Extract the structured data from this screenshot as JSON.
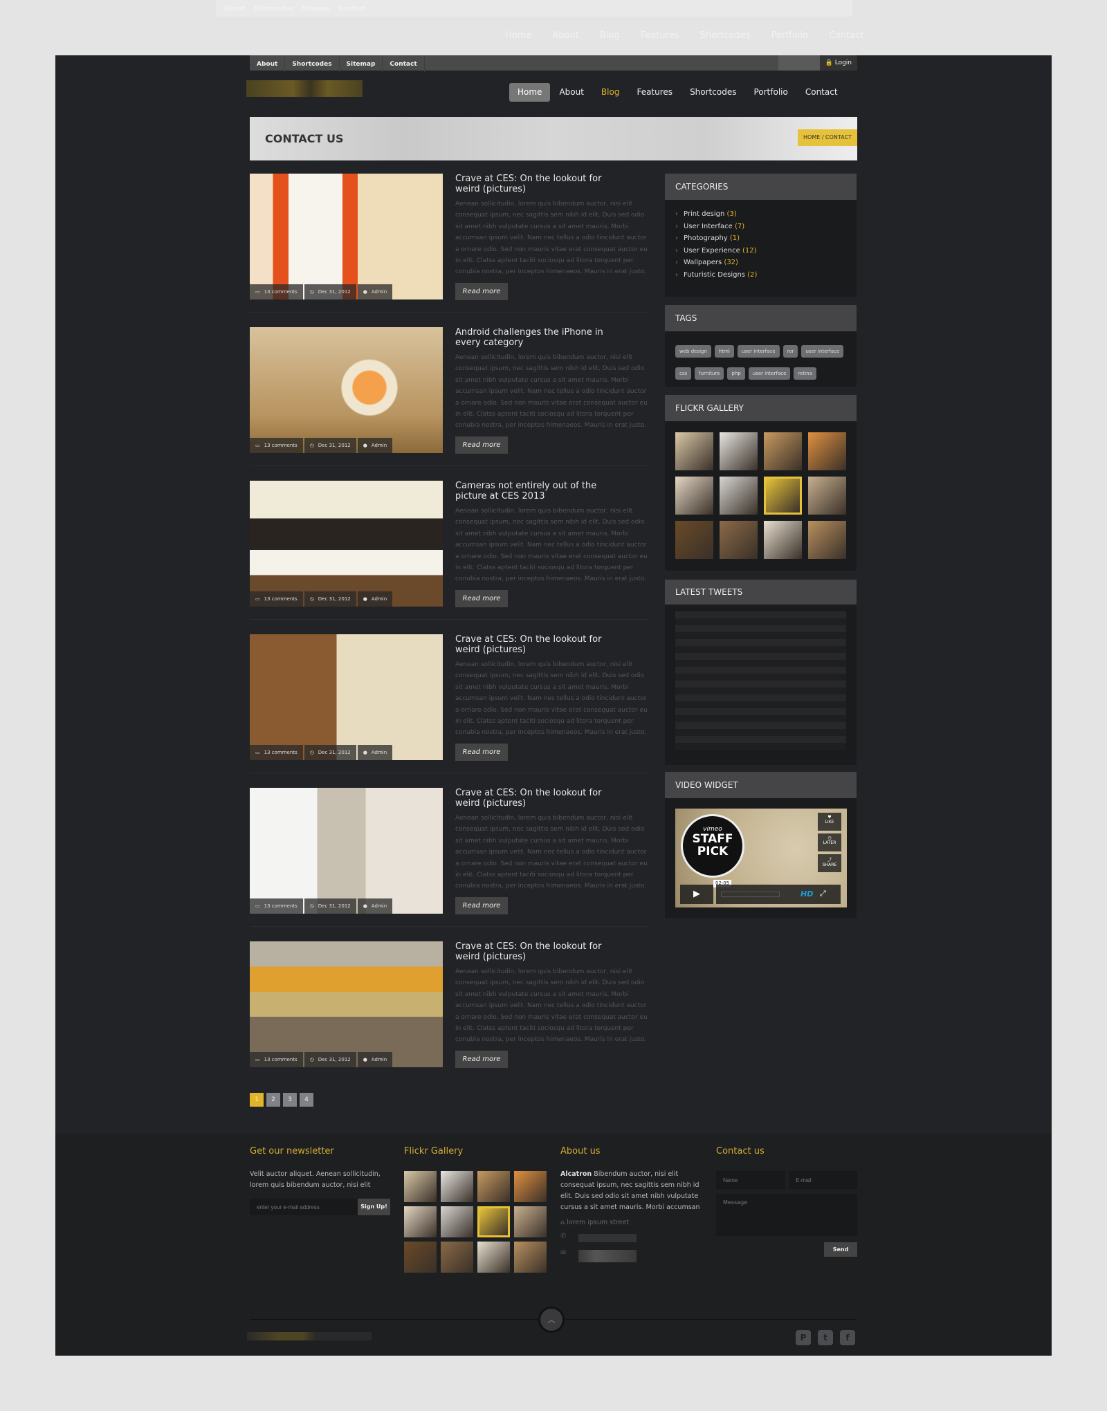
{
  "topbar": {
    "links": [
      "About",
      "Shortcodes",
      "Sitemap",
      "Contact"
    ],
    "login": "Login"
  },
  "nav": {
    "items": [
      "Home",
      "About",
      "Blog",
      "Features",
      "Shortcodes",
      "Portfolio",
      "Contact"
    ],
    "active": "Home"
  },
  "banner": {
    "title": "CONTACT US",
    "breadcrumb": "HOME / CONTACT"
  },
  "posts": [
    {
      "title": "Crave at CES: On the lookout for weird (pictures)",
      "comments": "13 comments",
      "date": "Dec 31, 2012",
      "author": "Admin"
    },
    {
      "title": "Android challenges the iPhone in every category",
      "comments": "13 comments",
      "date": "Dec 31, 2012",
      "author": "Admin"
    },
    {
      "title": "Cameras not entirely out of the picture at CES 2013",
      "comments": "13 comments",
      "date": "Dec 31, 2012",
      "author": "Admin"
    },
    {
      "title": "Crave at CES: On the lookout for weird (pictures)",
      "comments": "13 comments",
      "date": "Dec 31, 2012",
      "author": "Admin"
    },
    {
      "title": "Crave at CES: On the lookout for weird (pictures)",
      "comments": "13 comments",
      "date": "Dec 31, 2012",
      "author": "Admin"
    },
    {
      "title": "Crave at CES: On the lookout for weird (pictures)",
      "comments": "13 comments",
      "date": "Dec 31, 2012",
      "author": "Admin"
    }
  ],
  "post_excerpt": "Aenean sollicitudin, lorem quis bibendum auctor, nisi elit consequat ipsum, nec sagittis sem nibh id elit. Duis sed odio sit amet nibh vulputate cursus a sit amet mauris. Morbi accumsan ipsum velit. Nam nec tellus a odio tincidunt auctor a ornare odio. Sed non  mauris vitae erat consequat auctor eu in elit. Clatss aptent taciti sociosqu ad litora torquent per conubia nostra, per inceptos himenaeos. Mauris in erat justo.",
  "read_more": "Read more",
  "sidebar": {
    "categories": {
      "title": "CATEGORIES",
      "items": [
        {
          "label": "Print design",
          "count": "(3)"
        },
        {
          "label": "User Interface",
          "count": "(7)"
        },
        {
          "label": "Photography",
          "count": "(1)"
        },
        {
          "label": "User Experience",
          "count": "(12)"
        },
        {
          "label": "Wallpapers",
          "count": "(32)"
        },
        {
          "label": "Futuristic Designs",
          "count": "(2)"
        }
      ]
    },
    "tags": {
      "title": "TAGS",
      "items": [
        "web design",
        "html",
        "user interface",
        "ror",
        "user interface",
        "css",
        "furniture",
        "php",
        "user interface",
        "retina"
      ]
    },
    "flickr": {
      "title": "FLICKR GALLERY"
    },
    "tweets": {
      "title": "LATEST TWEETS"
    },
    "video": {
      "title": "VIDEO WIDGET",
      "badge_brand": "vimeo",
      "badge_text": "STAFF PICK",
      "time": "02:05",
      "like": "LIKE",
      "later": "LATER",
      "share": "SHARE",
      "hd": "HD"
    }
  },
  "pagination": {
    "pages": [
      "1",
      "2",
      "3",
      "4"
    ],
    "current": "1"
  },
  "footer": {
    "newsletter": {
      "title": "Get our newsletter",
      "text": "Velit auctor aliquet. Aenean sollicitudin, lorem quis bibendum auctor, nisi elit",
      "placeholder": "enter your e-mail address",
      "button": "Sign Up!"
    },
    "flickr": {
      "title": "Flickr Gallery"
    },
    "about": {
      "title": "About us",
      "brand": "Alcatron",
      "text": " Bibendum auctor, nisi elit consequat ipsum, nec sagittis sem nibh id elit. Duis sed odio sit amet nibh vulputate cursus a sit amet mauris. Morbi accumsan",
      "address": "lorem ipsum street"
    },
    "contact": {
      "title": "Contact us",
      "name_placeholder": "Name",
      "email_placeholder": "E-mail",
      "message_placeholder": "Message",
      "button": "Send"
    }
  },
  "colors": {
    "accent": "#e0b52a",
    "background": "#222326",
    "page": "#e4e4e4"
  }
}
